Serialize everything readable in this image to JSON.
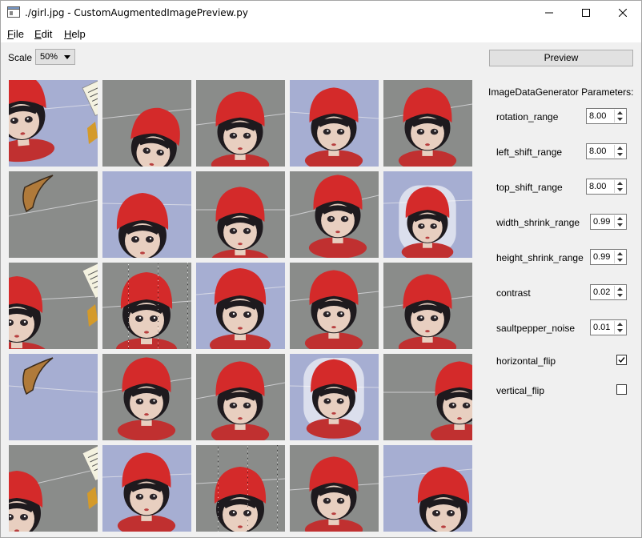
{
  "window": {
    "title": "./girl.jpg - CustomAugmentedImagePreview.py",
    "minimize_icon": "minimize-icon",
    "maximize_icon": "maximize-icon",
    "close_icon": "close-icon"
  },
  "menu": [
    {
      "key": "F",
      "rest": "ile"
    },
    {
      "key": "E",
      "rest": "dit"
    },
    {
      "key": "H",
      "rest": "elp"
    }
  ],
  "toolbar": {
    "scale_label": "Scale",
    "scale_value": "50%",
    "preview_label": "Preview"
  },
  "params": {
    "title": "ImageDataGenerator Parameters:",
    "rotation_range": {
      "label": "rotation_range",
      "value": "8.00"
    },
    "left_shift_range": {
      "label": "left_shift_range",
      "value": "8.00"
    },
    "top_shift_range": {
      "label": "top_shift_range",
      "value": "8.00"
    },
    "width_shrink_range": {
      "label": "width_shrink_range",
      "value": "0.99"
    },
    "height_shrink_range": {
      "label": "height_shrink_range",
      "value": "0.99"
    },
    "contrast": {
      "label": "contrast",
      "value": "0.02"
    },
    "saultpepper_noise": {
      "label": "saultpepper_noise",
      "value": "0.01"
    },
    "horizontal_flip": {
      "label": "horizontal_flip",
      "checked": true
    },
    "vertical_flip": {
      "label": "vertical_flip",
      "checked": false
    }
  },
  "images": {
    "count": 25,
    "colors": {
      "red_hat": "#d42a2a",
      "face": "#e8cfc0",
      "hair": "#1e1a1e",
      "bg_gray": "#8a8c8a",
      "bg_blue": "#a6aed2"
    }
  }
}
